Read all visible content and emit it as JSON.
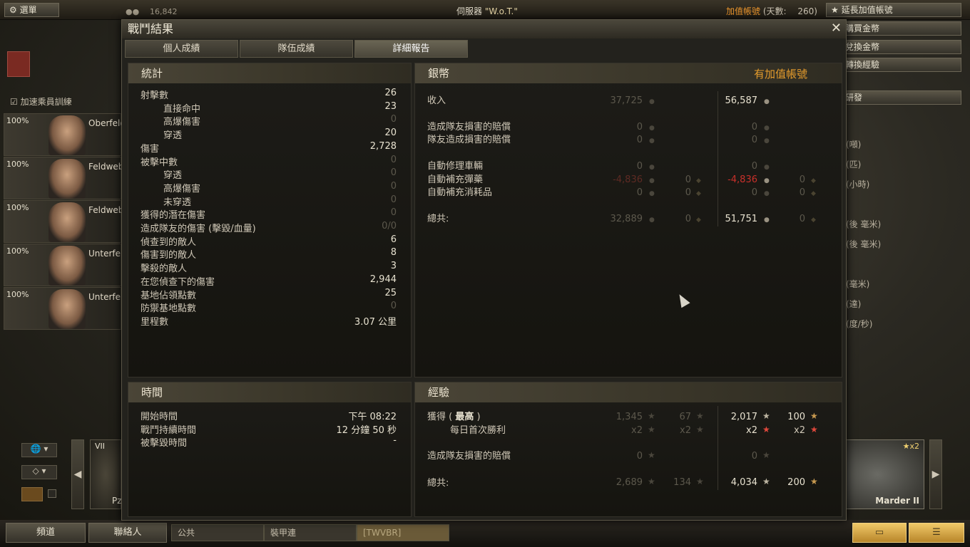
{
  "topbar": {
    "menu": "選單",
    "online_count": "16,842",
    "server_label": "伺服器",
    "server_name": "\"W.o.T.\"",
    "premium_label": "加值帳號",
    "days_label": "(天數:",
    "days_value": "260)",
    "extend_button": "延長加值帳號"
  },
  "side_buttons": [
    "購買金幣",
    "兌換金幣",
    "轉換經驗",
    "研發"
  ],
  "side_labels": [
    "(噸)",
    "(匹)",
    "(小時)",
    "(後 毫米)",
    "(後 毫米)",
    "(毫米)",
    "(達)",
    "(度/秒)"
  ],
  "left_panel": {
    "training_label": "加速乘員訓練",
    "crew": [
      {
        "pct": "100%",
        "name": "Oberfeld"
      },
      {
        "pct": "100%",
        "name": "Feldweb"
      },
      {
        "pct": "100%",
        "name": "Feldweb"
      },
      {
        "pct": "100%",
        "name": "Unterfel"
      },
      {
        "pct": "100%",
        "name": "Unterfel"
      }
    ]
  },
  "vehicle": {
    "name": "Marder II",
    "tier": "VII",
    "multiplier": "x2",
    "tank_left_label": "Pz"
  },
  "bottom": {
    "channels": "頻道",
    "contacts": "聯絡人",
    "tab_public": "公共",
    "tab_company": "裝甲連",
    "tab_clan": "[TWVBR]"
  },
  "dialog": {
    "title": "戰鬥結果",
    "tabs": [
      "個人成績",
      "隊伍成績",
      "詳細報告"
    ],
    "stats": {
      "header": "統計",
      "rows": [
        {
          "label": "射擊數",
          "value": "26",
          "indent": false,
          "dim": false
        },
        {
          "label": "直接命中",
          "value": "23",
          "indent": true,
          "dim": false
        },
        {
          "label": "高爆傷害",
          "value": "0",
          "indent": true,
          "dim": true
        },
        {
          "label": "穿透",
          "value": "20",
          "indent": true,
          "dim": false
        },
        {
          "label": "傷害",
          "value": "2,728",
          "indent": false,
          "dim": false
        },
        {
          "label": "被擊中數",
          "value": "0",
          "indent": false,
          "dim": true
        },
        {
          "label": "穿透",
          "value": "0",
          "indent": true,
          "dim": true
        },
        {
          "label": "高爆傷害",
          "value": "0",
          "indent": true,
          "dim": true
        },
        {
          "label": "未穿透",
          "value": "0",
          "indent": true,
          "dim": true
        },
        {
          "label": "獲得的潛在傷害",
          "value": "0",
          "indent": false,
          "dim": true
        },
        {
          "label": "造成隊友的傷害 (擊毀/血量)",
          "value": "0/0",
          "indent": false,
          "dim": true
        },
        {
          "label": "偵查到的敵人",
          "value": "6",
          "indent": false,
          "dim": false
        },
        {
          "label": "傷害到的敵人",
          "value": "8",
          "indent": false,
          "dim": false
        },
        {
          "label": "擊殺的敵人",
          "value": "3",
          "indent": false,
          "dim": false
        },
        {
          "label": "在您偵查下的傷害",
          "value": "2,944",
          "indent": false,
          "dim": false
        },
        {
          "label": "基地佔領點數",
          "value": "25",
          "indent": false,
          "dim": false
        },
        {
          "label": "防禦基地點數",
          "value": "0",
          "indent": false,
          "dim": true
        },
        {
          "label": "里程數",
          "value": "3.07 公里",
          "indent": false,
          "dim": false
        }
      ]
    },
    "credits": {
      "header": "銀幣",
      "premium_header": "有加值帳號",
      "income_label": "收入",
      "income_base": "37,725",
      "income_prem": "56,587",
      "tk_comp_label": "造成隊友損害的賠償",
      "tk_comp_base": "0",
      "tk_comp_prem": "0",
      "team_comp_label": "隊友造成損害的賠償",
      "team_comp_base": "0",
      "team_comp_prem": "0",
      "repair_label": "自動修理車輛",
      "repair_base": "0",
      "repair_prem": "0",
      "ammo_label": "自動補充彈藥",
      "ammo_base": "-4,836",
      "ammo_base_gold": "0",
      "ammo_prem": "-4,836",
      "ammo_prem_gold": "0",
      "consum_label": "自動補充消耗品",
      "consum_base": "0",
      "consum_base_gold": "0",
      "consum_prem": "0",
      "consum_prem_gold": "0",
      "total_label": "總共:",
      "total_base": "32,889",
      "total_base_gold": "0",
      "total_prem": "51,751",
      "total_prem_gold": "0"
    },
    "time": {
      "header": "時間",
      "start_label": "開始時間",
      "start_value": "下午 08:22",
      "duration_label": "戰鬥持續時間",
      "duration_value": "12 分鐘 50 秒",
      "destroyed_label": "被擊毀時間",
      "destroyed_value": "-"
    },
    "xp": {
      "header": "經驗",
      "earned_label": "獲得 (",
      "earned_best": "最高",
      "earned_close": ")",
      "earned_base": "1,345",
      "earned_base_free": "67",
      "earned_prem": "2,017",
      "earned_prem_free": "100",
      "daily_label": "每日首次勝利",
      "daily_base": "x2",
      "daily_base_free": "x2",
      "daily_prem": "x2",
      "daily_prem_free": "x2",
      "tk_label": "造成隊友損害的賠償",
      "tk_base": "0",
      "tk_prem": "0",
      "total_label": "總共:",
      "total_base": "2,689",
      "total_base_free": "134",
      "total_prem": "4,034",
      "total_prem_free": "200"
    }
  }
}
